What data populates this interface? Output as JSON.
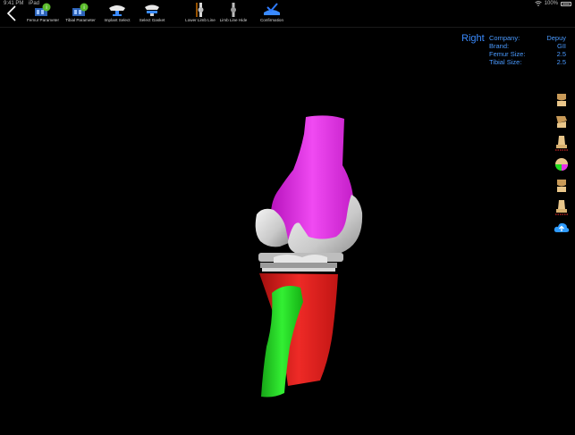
{
  "status_bar": {
    "time": "9:41 PM",
    "carrier": "iPad",
    "battery": "100%"
  },
  "toolbar": {
    "tools": [
      {
        "label": "Femur Parameter",
        "icon": "femur-parameter-icon"
      },
      {
        "label": "Tibial Parameter",
        "icon": "tibial-parameter-icon"
      },
      {
        "label": "Implant Select",
        "icon": "implant-select-icon"
      },
      {
        "label": "Select Gasket",
        "icon": "select-gasket-icon"
      },
      {
        "label": "Lower Limb Line",
        "icon": "lower-limb-line-icon"
      },
      {
        "label": "Limb Line Hide",
        "icon": "limb-line-hide-icon"
      },
      {
        "label": "Confirmation",
        "icon": "confirmation-icon"
      }
    ]
  },
  "info": {
    "side": "Right",
    "rows": [
      {
        "key": "Company:",
        "value": "Depuy"
      },
      {
        "key": "Brand:",
        "value": "GII"
      },
      {
        "key": "Femur Size:",
        "value": "2.5"
      },
      {
        "key": "Tibial  Size:",
        "value": "2.5"
      }
    ]
  },
  "view_rail": {
    "buttons": [
      {
        "icon": "view-lateral-icon"
      },
      {
        "icon": "view-medial-icon"
      },
      {
        "icon": "view-anterior-icon"
      },
      {
        "icon": "view-color-map-icon"
      },
      {
        "icon": "view-posterior-icon"
      },
      {
        "icon": "view-axial-icon"
      },
      {
        "icon": "cloud-upload-icon"
      }
    ]
  },
  "colors": {
    "accent": "#3a8bff",
    "femur": "#e42fe6",
    "tibia": "#e5201f",
    "fibula": "#1fdc1f",
    "implant": "#d4d4d4"
  }
}
